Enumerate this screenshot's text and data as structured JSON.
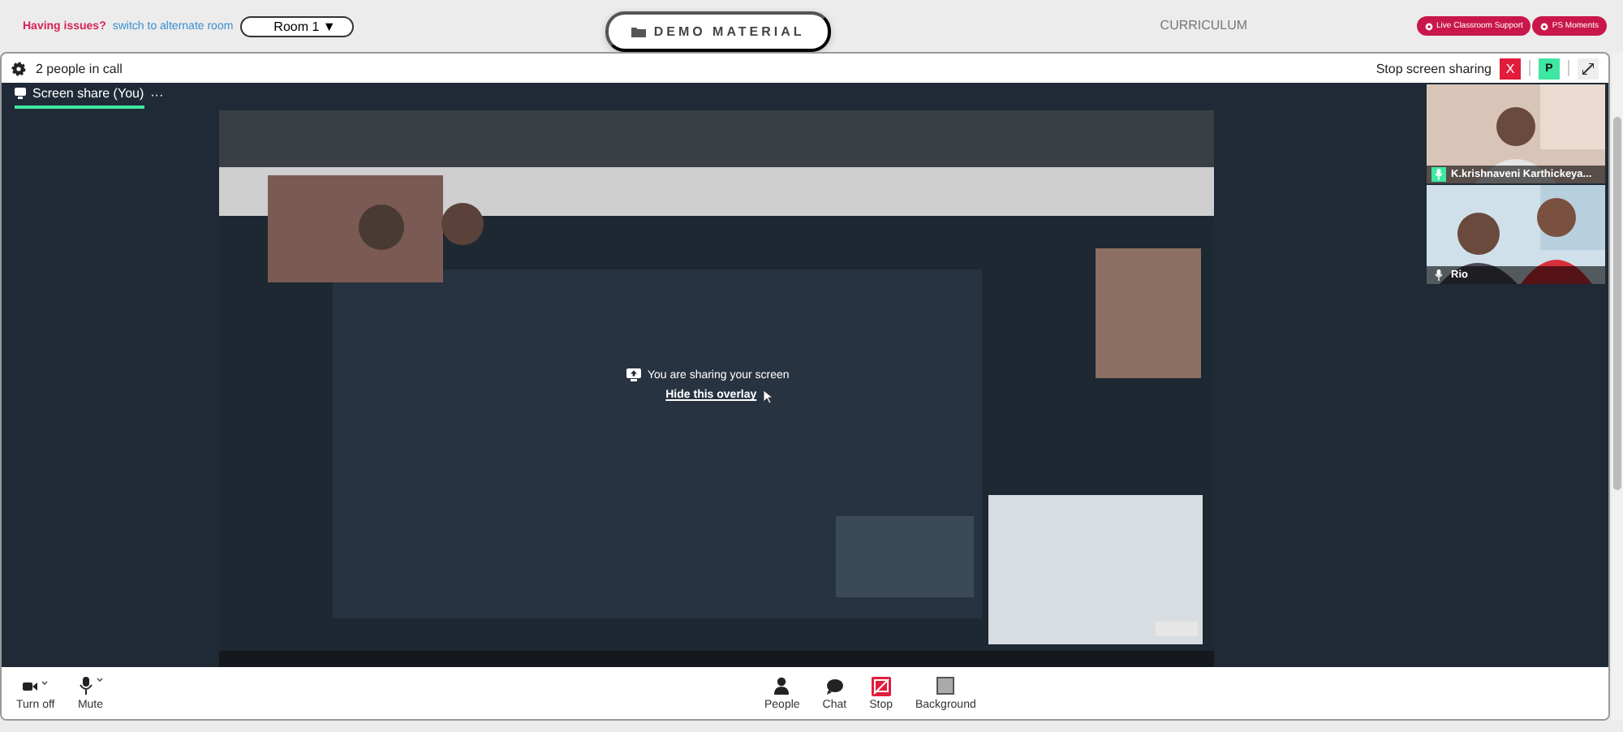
{
  "top_bar": {
    "issue_label": "Having issues?",
    "issue_link": "switch to alternate room",
    "room_select": "Room 1 ▼",
    "demo_button": "DEMO MATERIAL",
    "curriculum_tab": "CURRICULUM",
    "buttons": [
      {
        "label": "Live Classroom Support"
      },
      {
        "label": "PS Moments"
      }
    ]
  },
  "call_header": {
    "people_count": "2 people in call",
    "stop_label": "Stop screen sharing",
    "stop_button": "X",
    "avatar_button": "P"
  },
  "stage": {
    "tab": {
      "label": "Screen share (You)",
      "more": "···",
      "selected": true
    },
    "overlay": {
      "message": "You are sharing your screen",
      "hide_link": "Hide this overlay"
    },
    "participants": [
      {
        "name": "K.krishnaveni Karthickeya...",
        "speaking": true
      },
      {
        "name": "Rio",
        "speaking": false
      }
    ]
  },
  "toolbar": {
    "left": [
      {
        "kind": "camera",
        "label": "Turn off"
      },
      {
        "kind": "mic",
        "label": "Mute"
      }
    ],
    "center": [
      {
        "kind": "people",
        "label": "People",
        "active": false
      },
      {
        "kind": "chat",
        "label": "Chat",
        "active": false
      },
      {
        "kind": "stop",
        "label": "Stop",
        "active": true
      },
      {
        "kind": "background",
        "label": "Background",
        "active": false
      }
    ]
  }
}
